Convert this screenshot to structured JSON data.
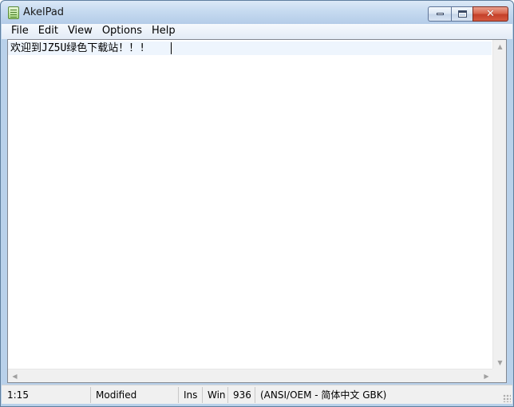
{
  "window": {
    "title": "AkelPad"
  },
  "caption_buttons": {
    "minimize": "minimize-icon",
    "maximize": "maximize-icon",
    "close": "close-icon"
  },
  "menu": {
    "items": [
      {
        "label": "File"
      },
      {
        "label": "Edit"
      },
      {
        "label": "View"
      },
      {
        "label": "Options"
      },
      {
        "label": "Help"
      }
    ]
  },
  "editor": {
    "content": "欢迎到JZ5U绿色下载站！！!"
  },
  "statusbar": {
    "position": "1:15",
    "modified": "Modified",
    "insert_mode": "Ins",
    "newline": "Win",
    "codepage": "936",
    "encoding": "(ANSI/OEM - 简体中文 GBK)"
  },
  "colors": {
    "titlebar": "#c6daf0",
    "close_button": "#c4402a",
    "active_line": "#eef5fd"
  }
}
